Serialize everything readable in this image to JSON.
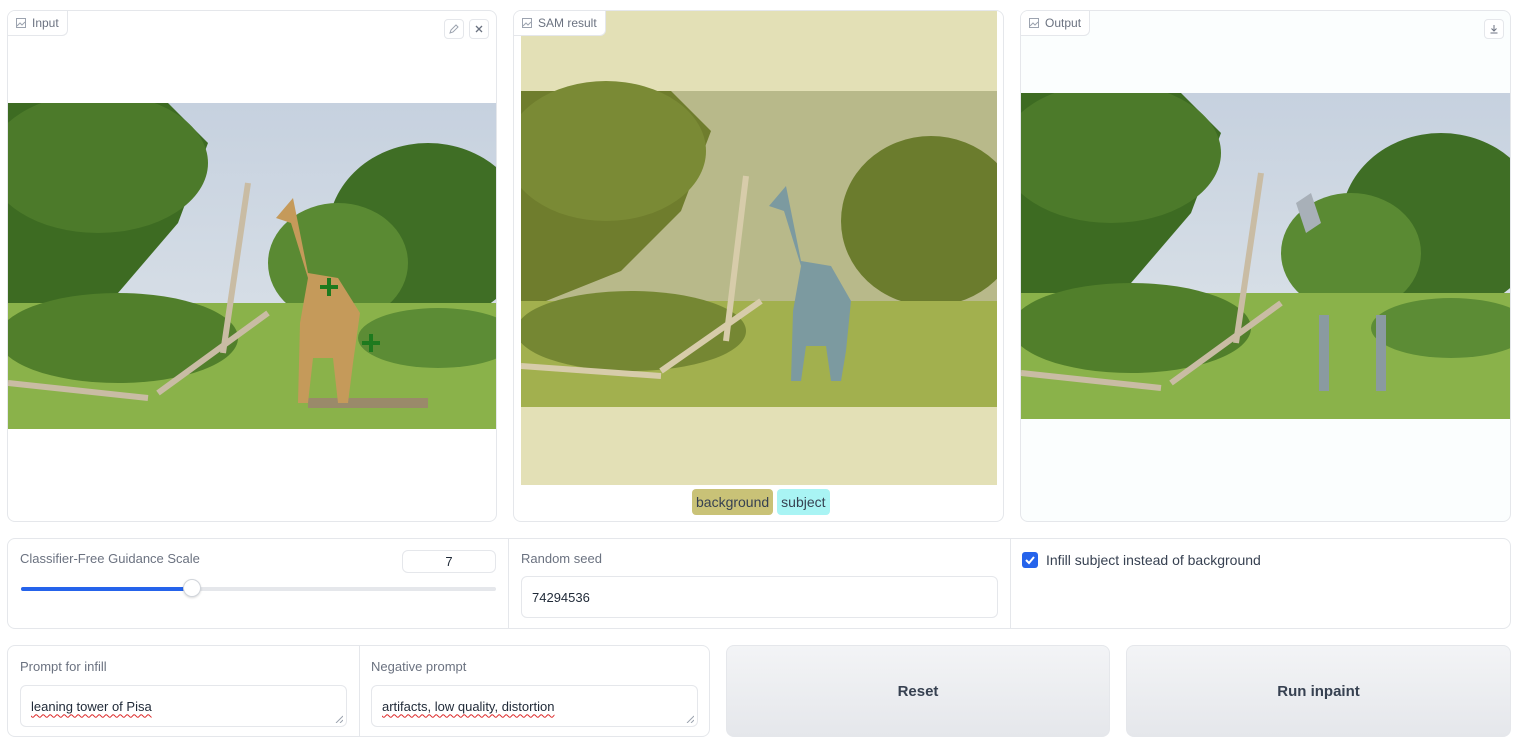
{
  "panels": {
    "input": {
      "label": "Input"
    },
    "sam": {
      "label": "SAM result",
      "legend": [
        {
          "text": "background",
          "color": "#c9c277"
        },
        {
          "text": "subject",
          "color": "#a9f4f4"
        }
      ]
    },
    "output": {
      "label": "Output"
    }
  },
  "controls": {
    "cfg": {
      "label": "Classifier-Free Guidance Scale",
      "value": "7",
      "slider_fraction": 0.36
    },
    "seed": {
      "label": "Random seed",
      "value": "74294536"
    },
    "infill": {
      "label": "Infill subject instead of background",
      "checked": true
    }
  },
  "prompts": {
    "infill": {
      "label": "Prompt for infill",
      "value": "leaning tower of Pisa"
    },
    "negative": {
      "label": "Negative prompt",
      "value": "artifacts, low quality, distortion"
    }
  },
  "buttons": {
    "reset": "Reset",
    "run": "Run inpaint"
  },
  "colors": {
    "accent": "#2563eb",
    "sam_bg": "#e3e0b6"
  }
}
